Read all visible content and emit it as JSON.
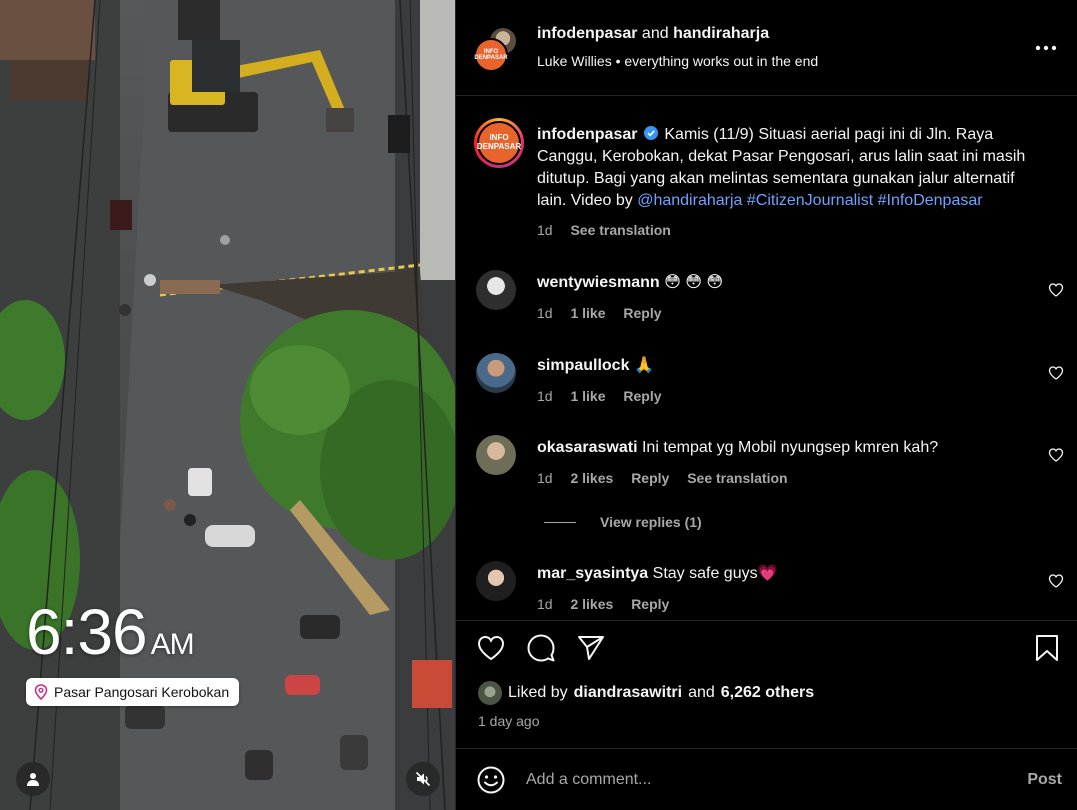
{
  "header": {
    "user1": "infodenpasar",
    "joiner": "and",
    "user2": "handiraharja",
    "audio_artist": "Luke Willies",
    "audio_sep": "•",
    "audio_track": "everything works out in the end",
    "more_icon": "more-horizontal-icon"
  },
  "brand_avatar_text": "INFO DENPASAR",
  "media": {
    "time": "6:36",
    "ampm": "AM",
    "location": "Pasar Pangosari Kerobokan",
    "location_icon": "location-pin-icon",
    "user_tag_icon": "person-icon",
    "mute_icon": "speaker-muted-icon"
  },
  "caption": {
    "username": "infodenpasar",
    "verified_icon": "verified-badge-icon",
    "text": "Kamis (11/9) Situasi aerial pagi ini di Jln. Raya Canggu, Kerobokan, dekat Pasar Pengosari, arus lalin saat ini masih ditutup. Bagi yang akan melintas sementara gunakan jalur alternatif lain. Video by ",
    "mention": "@handiraharja",
    "hashtag1": "#CitizenJournalist",
    "hashtag2": "#InfoDenpasar",
    "age": "1d",
    "see_translation": "See translation"
  },
  "comments": [
    {
      "username": "wentywiesmann",
      "text": "😳 😳 😳",
      "age": "1d",
      "likes": "1 like",
      "reply": "Reply",
      "translate": ""
    },
    {
      "username": "simpaullock",
      "text": "🙏",
      "age": "1d",
      "likes": "1 like",
      "reply": "Reply",
      "translate": ""
    },
    {
      "username": "okasaraswati",
      "text": "Ini tempat yg Mobil nyungsep kmren kah?",
      "age": "1d",
      "likes": "2 likes",
      "reply": "Reply",
      "translate": "See translation"
    },
    {
      "username": "mar_syasintya",
      "text": "Stay safe guys💗",
      "age": "1d",
      "likes": "2 likes",
      "reply": "Reply",
      "translate": ""
    }
  ],
  "view_replies": "View replies (1)",
  "actions": {
    "like_icon": "heart-icon",
    "comment_icon": "comment-bubble-icon",
    "share_icon": "paper-plane-icon",
    "save_icon": "bookmark-icon"
  },
  "likes": {
    "prefix": "Liked by",
    "user": "diandrasawitri",
    "middle": "and",
    "others": "6,262 others"
  },
  "posted_time": "1 day ago",
  "comment_box": {
    "emoji_icon": "emoji-smiley-icon",
    "placeholder": "Add a comment...",
    "post_label": "Post"
  }
}
